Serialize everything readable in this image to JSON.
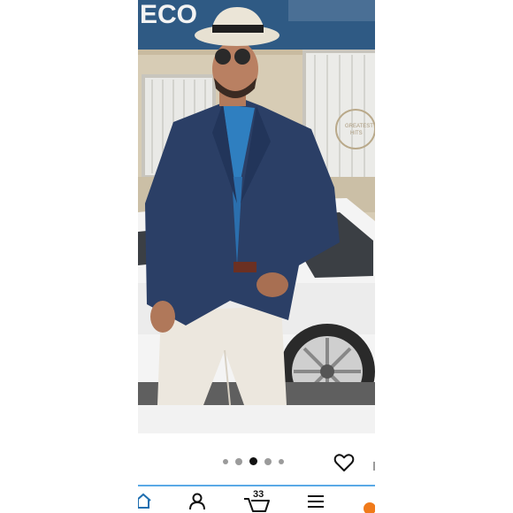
{
  "product": {
    "image_alt": "Man in navy blazer, blue shirt, white trousers and white fedora standing in front of a white car",
    "storefront_sign_partial": "ECO",
    "window_decal_lines": [
      "GREATEST",
      "HITS"
    ]
  },
  "carousel": {
    "total_dots": 5,
    "active_index": 2
  },
  "wishlist": {
    "icon": "heart-outline-icon"
  },
  "nav": {
    "items": [
      {
        "name": "home",
        "icon": "home-icon"
      },
      {
        "name": "account",
        "icon": "person-icon"
      },
      {
        "name": "cart",
        "icon": "cart-icon",
        "count": "33"
      },
      {
        "name": "menu",
        "icon": "menu-icon"
      }
    ],
    "accent_color": "#5aa9e6",
    "badge_color": "#f07a1a"
  }
}
